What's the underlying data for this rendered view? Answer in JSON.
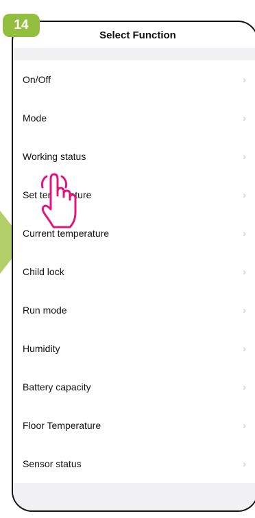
{
  "step_badge": "14",
  "header": {
    "title": "Select Function"
  },
  "functions": [
    {
      "label": "On/Off"
    },
    {
      "label": "Mode"
    },
    {
      "label": "Working status"
    },
    {
      "label": "Set temperature"
    },
    {
      "label": "Current temperature"
    },
    {
      "label": "Child lock"
    },
    {
      "label": "Run mode"
    },
    {
      "label": "Humidity"
    },
    {
      "label": "Battery capacity"
    },
    {
      "label": "Floor Temperature"
    },
    {
      "label": "Sensor status"
    }
  ],
  "chevron": "›",
  "colors": {
    "badge": "#94be3f",
    "pointer_arrow": "#b3cf6a",
    "hand_outline": "#e0167e"
  }
}
